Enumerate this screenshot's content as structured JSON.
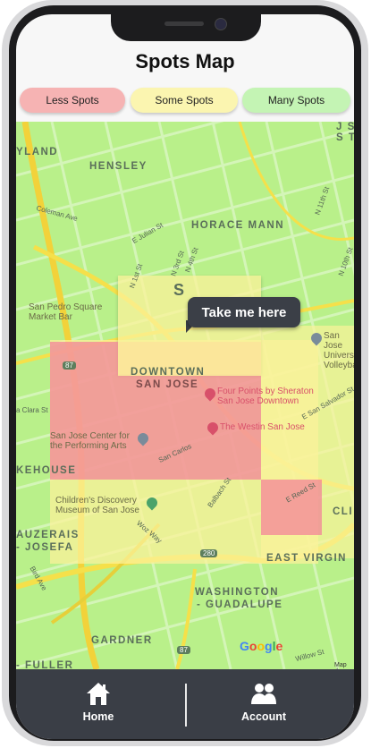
{
  "header": {
    "title": "Spots Map"
  },
  "legend": [
    {
      "label": "Less Spots",
      "color": "#f6b3b3"
    },
    {
      "label": "Some Spots",
      "color": "#fbf5b0"
    },
    {
      "label": "Many Spots",
      "color": "#c4f4b4"
    }
  ],
  "map": {
    "popup": "Take me here",
    "neighborhoods": {
      "n1": "YLAND",
      "hensley": "HENSLEY",
      "horace_mann": "HORACE MANN",
      "downtown": "DOWNTOWN",
      "san_jose": "SAN JOSE",
      "kehouse": "KEHOUSE",
      "auzerais": "AUZERAIS",
      "josefa": "- JOSEFA",
      "east_virgin": "EAST VIRGIN",
      "washington": "WASHINGTON",
      "guadalupe": "- GUADALUPE",
      "gardner": "GARDNER",
      "fuller": "- FULLER",
      "cli": "CLI",
      "js": "J S",
      "st": "S T",
      "s_letter": "S"
    },
    "streets": {
      "coleman": "Coleman Ave",
      "julian": "E Julian St",
      "n4th": "N 4th St",
      "n3rd": "N 3rd St",
      "n1st": "N 1st St",
      "n11th": "N 11th St",
      "n10th": "N 10th St",
      "clara": "a Clara St",
      "carlos": "San Carlos",
      "balbach": "Balbach St",
      "reed": "E Reed St",
      "woz": "Woz Way",
      "bird": "Bird Ave",
      "salvador": "E San Salvador St",
      "willow": "Willow St",
      "hwy87": "87",
      "hwy280": "280"
    },
    "pois": {
      "san_pedro": "San Pedro Square\nMarket Bar",
      "four_points": "Four Points by Sheraton\nSan Jose Downtown",
      "westin": "The Westin San Jose",
      "center": "San Jose Center for\nthe Performing Arts",
      "discovery": "Children's Discovery\nMuseum of San Jose",
      "univ": "San Jose\nUnivers\nVolleyba"
    },
    "attribution": "Google",
    "copyright": "Map da"
  },
  "nav": {
    "home_label": "Home",
    "account_label": "Account"
  },
  "colors": {
    "less": "#f27f98",
    "some": "#fbf29a",
    "bar": "#3a3e46"
  }
}
